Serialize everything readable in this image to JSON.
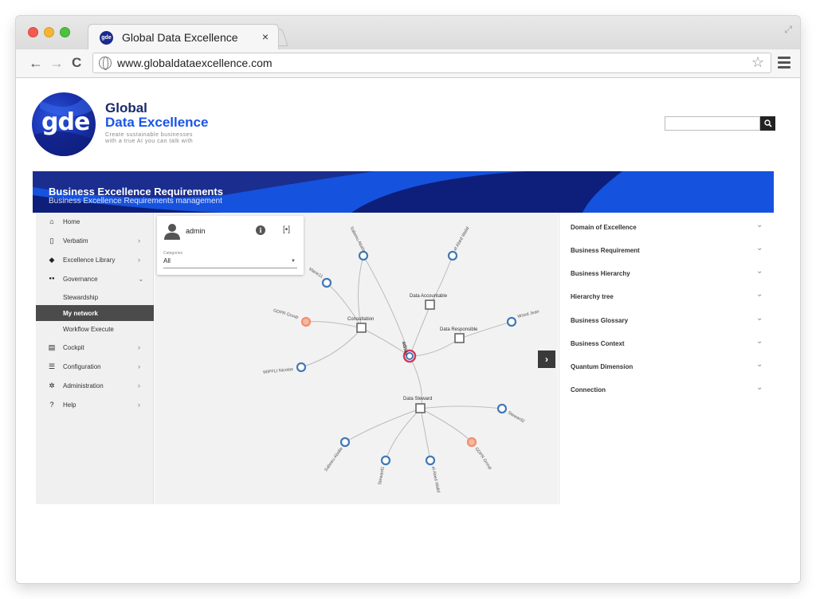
{
  "browser": {
    "tab_title": "Global Data Excellence",
    "tab_close": "×",
    "favicon_text": "gde",
    "url": "www.globaldataexcellence.com",
    "back": "←",
    "forward": "→",
    "reload": "C",
    "star": "☆",
    "expand": "⤢"
  },
  "header": {
    "logo_text": "gde",
    "brand_line1": "Global",
    "brand_line2": "Data Excellence",
    "tagline1": "Create sustainable businesses",
    "tagline2": "with a true AI you can talk with",
    "search_placeholder": "",
    "search_icon": "magnifier-icon"
  },
  "banner": {
    "title": "Business Excellence Requirements",
    "subtitle": "Business Excellence Requirements management",
    "color": "#1552de"
  },
  "sidebar": {
    "items": [
      {
        "label": "Home",
        "icon": "home-icon",
        "glyph": "⌂",
        "chevron": ""
      },
      {
        "label": "Verbatim",
        "icon": "book-icon",
        "glyph": "▯",
        "chevron": "›"
      },
      {
        "label": "Excellence Library",
        "icon": "diamond-icon",
        "glyph": "◆",
        "chevron": "›"
      },
      {
        "label": "Governance",
        "icon": "people-icon",
        "glyph": "●●",
        "chevron": "⌄"
      },
      {
        "label": "Stewardship",
        "icon": "",
        "glyph": "",
        "chevron": ""
      },
      {
        "label": "My network",
        "icon": "",
        "glyph": "",
        "chevron": ""
      },
      {
        "label": "Workflow Execute",
        "icon": "",
        "glyph": "",
        "chevron": ""
      },
      {
        "label": "Cockpit",
        "icon": "dashboard-icon",
        "glyph": "▤",
        "chevron": "›"
      },
      {
        "label": "Configuration",
        "icon": "sliders-icon",
        "glyph": "☰",
        "chevron": "›"
      },
      {
        "label": "Administration",
        "icon": "gear-icon",
        "glyph": "✲",
        "chevron": "›"
      },
      {
        "label": "Help",
        "icon": "help-icon",
        "glyph": "?",
        "chevron": "›"
      }
    ]
  },
  "card": {
    "user": "admin",
    "info_glyph": "i",
    "focus_glyph": "[•]",
    "categories_label": "Categories",
    "categories_value": "All",
    "caret": "▼"
  },
  "graph": {
    "center": {
      "label": "admin"
    },
    "hubs": [
      {
        "key": "consultation",
        "label": "Consultation"
      },
      {
        "key": "accountable",
        "label": "Data Accountable"
      },
      {
        "key": "responsible",
        "label": "Data Responsible"
      },
      {
        "key": "steward",
        "label": "Data Steward"
      }
    ],
    "leaves": [
      {
        "label": "Sabeeu Abalia",
        "color": "#3f78b8"
      },
      {
        "label": "el Abed Walid",
        "color": "#3f78b8"
      },
      {
        "label": "Marie11",
        "color": "#3f78b8"
      },
      {
        "label": "GDPR Group",
        "color": "#f08f70"
      },
      {
        "label": "WIPFLI Nicolas",
        "color": "#3f78b8"
      },
      {
        "label": "Wood Jean",
        "color": "#3f78b8"
      },
      {
        "label": "Steward2",
        "color": "#3f78b8"
      },
      {
        "label": "Sabeeu Abalia",
        "color": "#3f78b8"
      },
      {
        "label": "Steward1",
        "color": "#3f78b8"
      },
      {
        "label": "el Abed Walid",
        "color": "#3f78b8"
      },
      {
        "label": "GDPR Group",
        "color": "#f08f70"
      }
    ],
    "expand_glyph": "›"
  },
  "panel": {
    "items": [
      {
        "label": "Domain of Excellence"
      },
      {
        "label": "Business Requirement"
      },
      {
        "label": "Business Hierarchy"
      },
      {
        "label": "Hierarchy tree"
      },
      {
        "label": "Business Glossary"
      },
      {
        "label": "Business Context"
      },
      {
        "label": "Quantum Dimension"
      },
      {
        "label": "Connection"
      }
    ],
    "chevron": "⌄"
  }
}
